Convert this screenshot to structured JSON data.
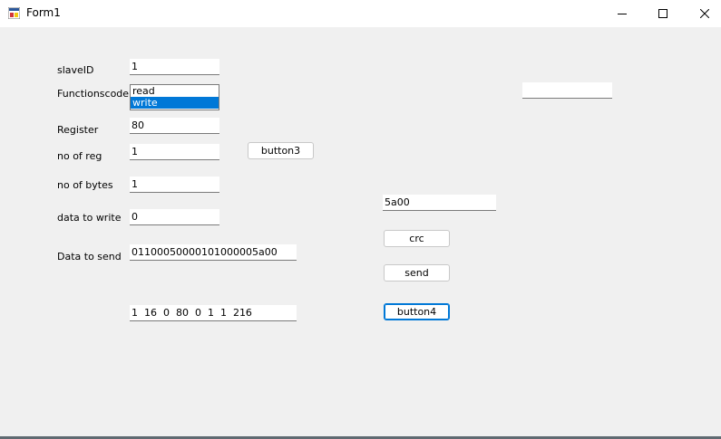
{
  "window": {
    "title": "Form1",
    "icons": {
      "app": "form-app-icon",
      "minimize": "minimize-icon",
      "maximize": "maximize-icon",
      "close": "close-icon"
    }
  },
  "form": {
    "labels": {
      "slave_id": "slaveID",
      "function_code": "Functionscode",
      "register": "Register",
      "no_of_reg": "no of reg",
      "no_of_bytes": "no of bytes",
      "data_to_write": "data to write",
      "data_to_send": "Data to send"
    },
    "fields": {
      "slave_id": "1",
      "register": "80",
      "no_of_reg": "1",
      "no_of_bytes": "1",
      "data_to_write": "0",
      "data_to_send": "01100050000101000005a00",
      "result_bytes": "1  16  0  80  0  1  1  216",
      "crc_value": "5a00",
      "top_right": ""
    },
    "function_code_options": [
      "read",
      "write"
    ],
    "function_code_selected": "write",
    "buttons": {
      "button3": "button3",
      "crc": "crc",
      "send": "send",
      "button4": "button4"
    }
  },
  "colors": {
    "selection": "#0078d7",
    "form_background": "#f0f0f0"
  }
}
